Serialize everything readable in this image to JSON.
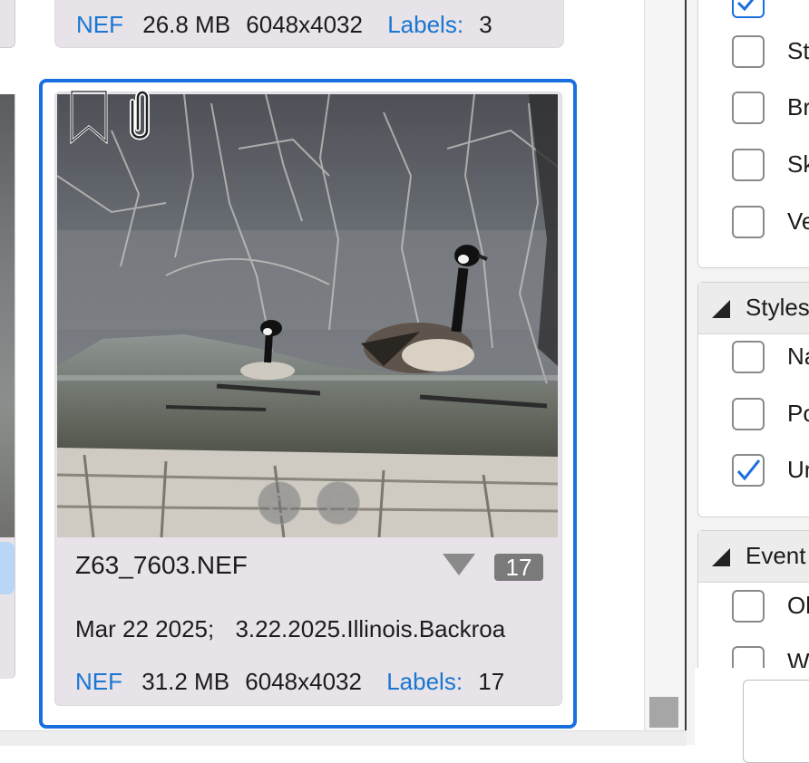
{
  "top_card": {
    "format": "NEF",
    "size": "26.8 MB",
    "dimensions": "6048x4032",
    "labels_label": "Labels:",
    "labels_count": "3"
  },
  "selected_card": {
    "filename": "Z63_7603.NEF",
    "label_count_badge": "17",
    "date": "Mar 22 2025;",
    "album": "3.22.2025.Illinois.Backroa",
    "format": "NEF",
    "size": "31.2 MB",
    "dimensions": "6048x4032",
    "labels_label": "Labels:",
    "labels_count": "17",
    "icons": [
      "bookmark-icon",
      "paperclip-icon",
      "rotate-left-icon",
      "rotate-right-icon",
      "dropdown-triangle-icon"
    ]
  },
  "right_panel": {
    "group1_items": [
      {
        "label": "St",
        "checked": false
      },
      {
        "label": "Br",
        "checked": false
      },
      {
        "label": "Sk",
        "checked": false
      },
      {
        "label": "Ve",
        "checked": false
      }
    ],
    "styles": {
      "title": "Styles",
      "items": [
        {
          "label": "Na",
          "checked": false
        },
        {
          "label": "Po",
          "checked": false
        },
        {
          "label": "Ur",
          "checked": true
        }
      ]
    },
    "events": {
      "title": "Event",
      "items": [
        {
          "label": "Ob",
          "checked": false
        },
        {
          "label": "W",
          "checked": false
        }
      ]
    }
  },
  "colors": {
    "selection_border": "#1a6fe0",
    "link_blue": "#1976d2",
    "checkmark": "#1a6fe0",
    "badge_bg": "#7a7a7a"
  }
}
